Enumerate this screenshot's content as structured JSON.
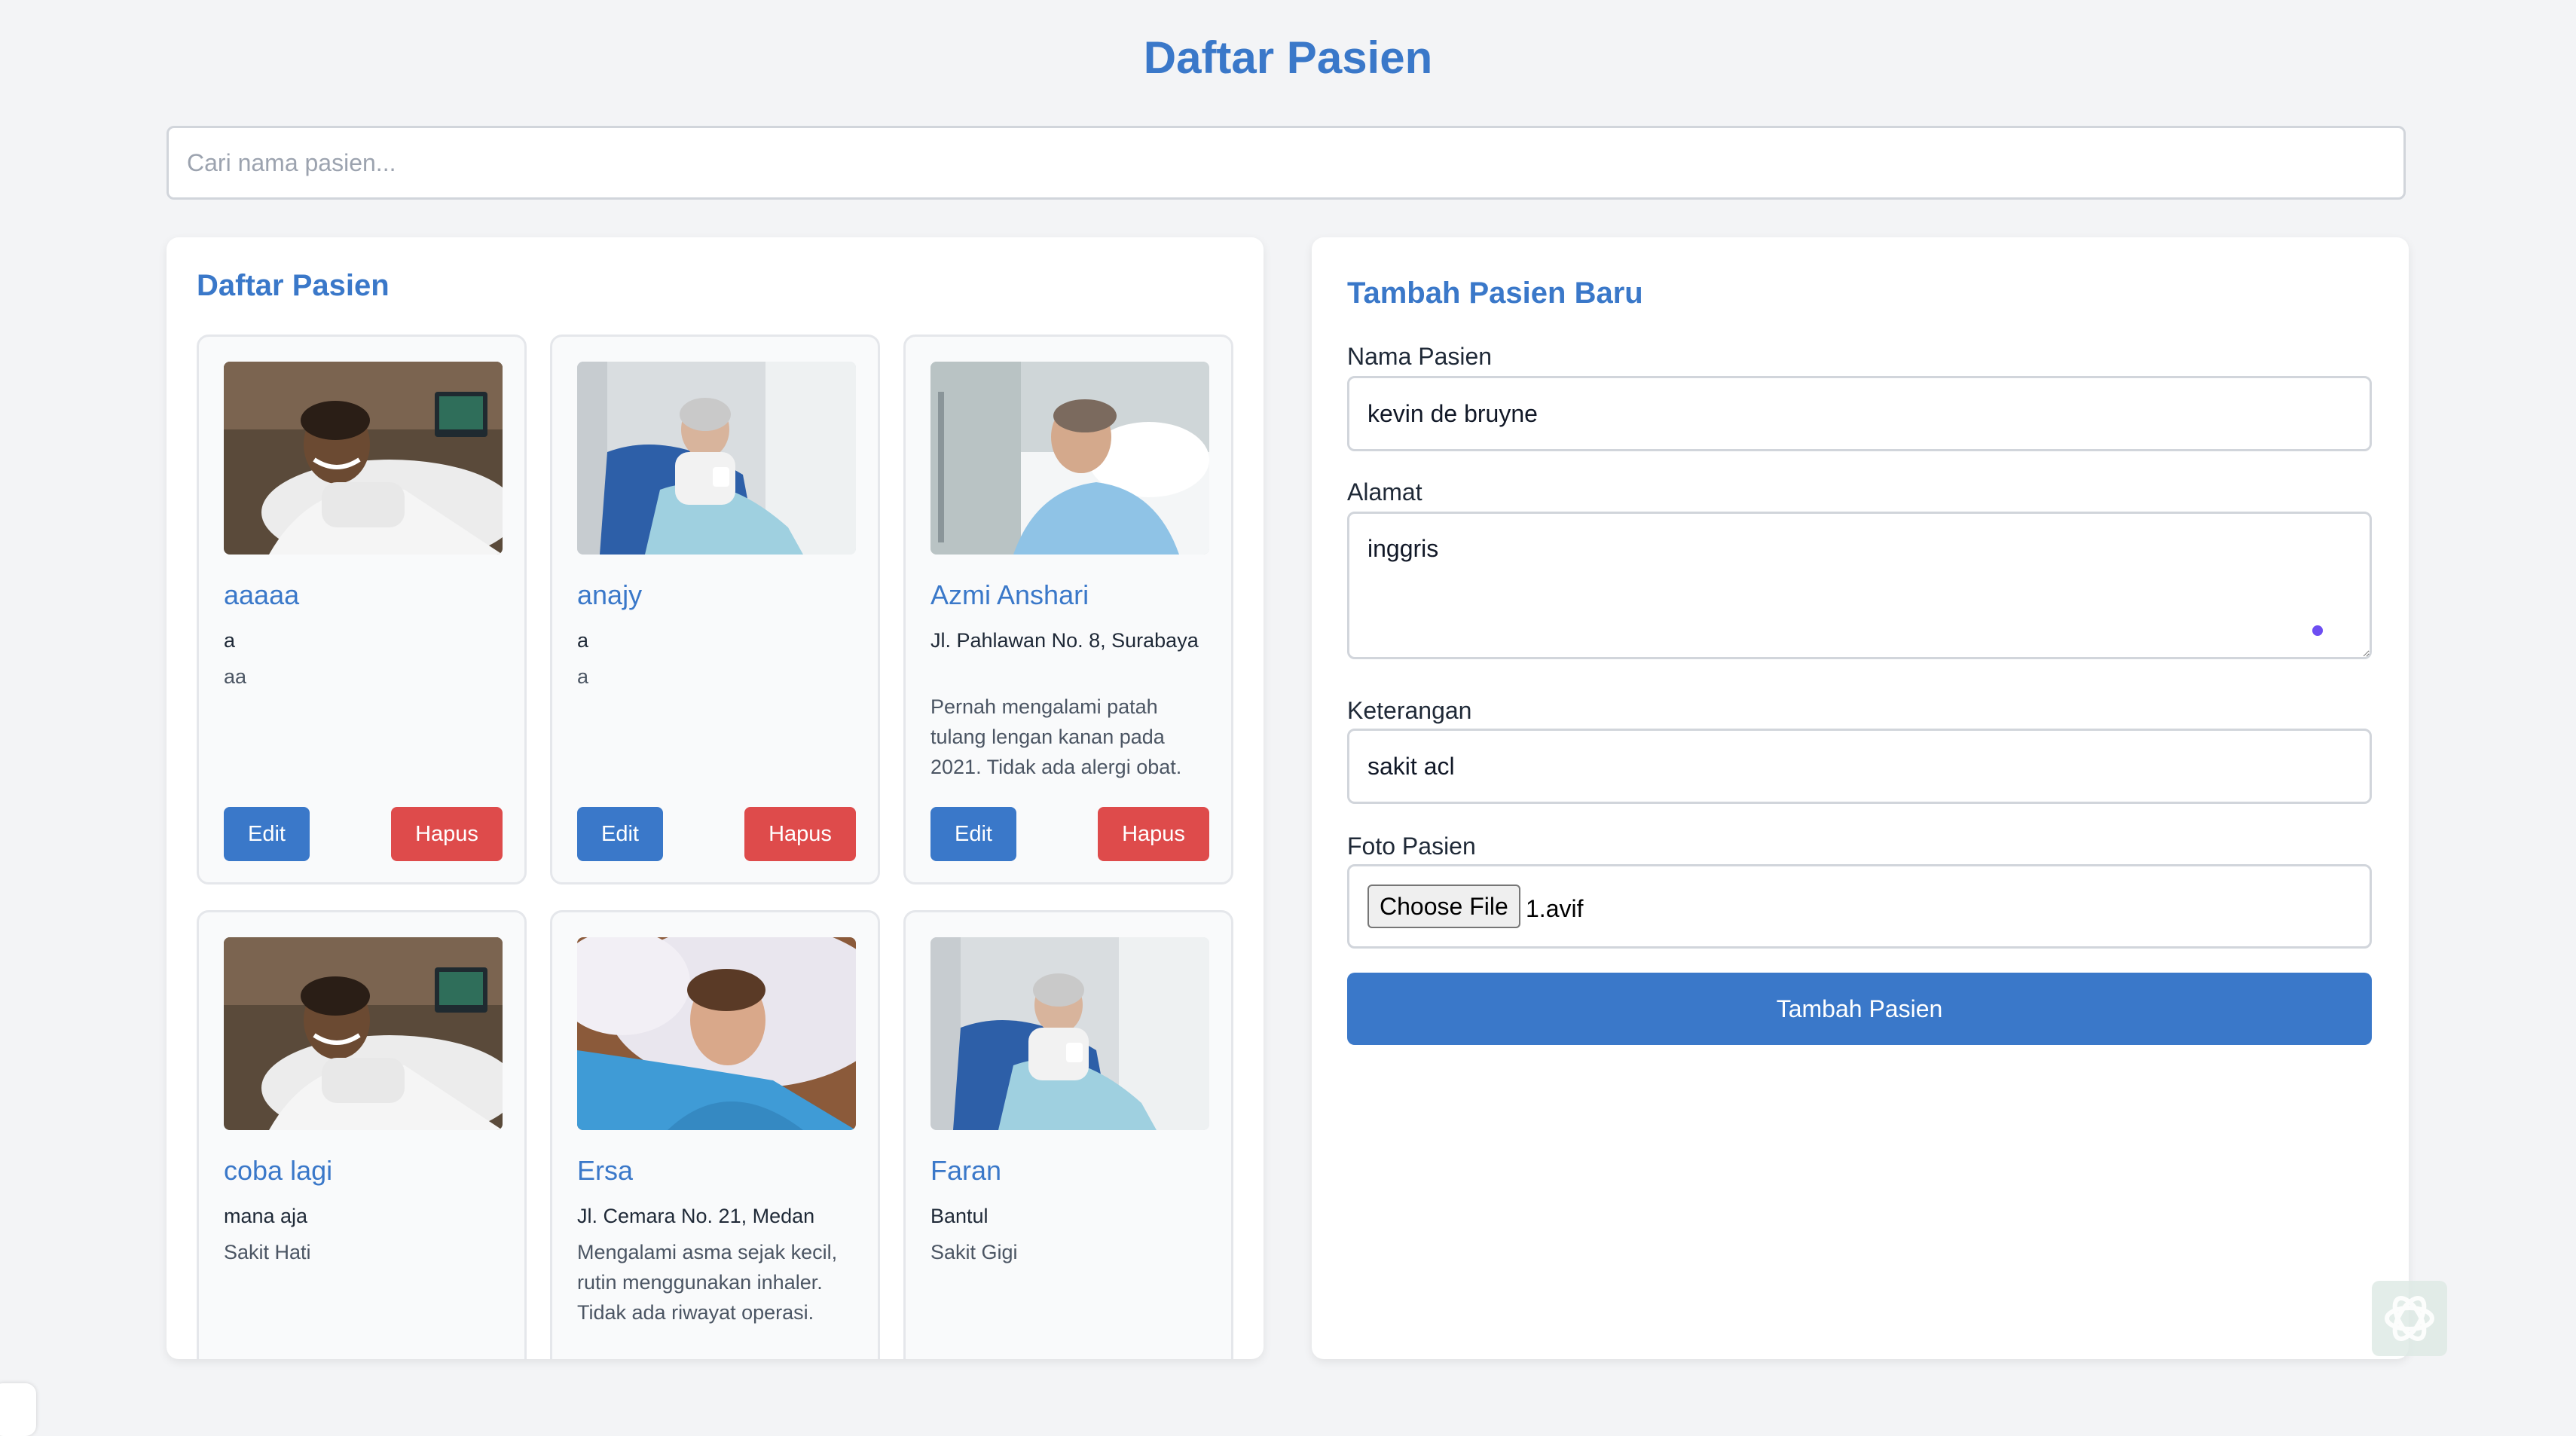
{
  "page": {
    "title": "Daftar Pasien"
  },
  "search": {
    "placeholder": "Cari nama pasien...",
    "icon": "search-icon"
  },
  "list_panel": {
    "title": "Daftar Pasien",
    "edit_label": "Edit",
    "delete_label": "Hapus",
    "patients": [
      {
        "name": "aaaaa",
        "address": "a",
        "notes": "aa",
        "photo": "patient-smiling-in-bed-photo"
      },
      {
        "name": "anajy",
        "address": "a",
        "notes": "a",
        "photo": "elderly-patient-in-chair-photo"
      },
      {
        "name": "Azmi Anshari",
        "address": "Jl. Pahlawan No. 8, Surabaya",
        "notes": "Pernah mengalami patah tulang lengan kanan pada 2021. Tidak ada alergi obat.",
        "photo": "patient-looking-up-photo"
      },
      {
        "name": "coba lagi",
        "address": "mana aja",
        "notes": "Sakit Hati",
        "photo": "patient-smiling-in-bed-photo"
      },
      {
        "name": "Ersa",
        "address": "Jl. Cemara No. 21, Medan",
        "notes": "Mengalami asma sejak kecil, rutin menggunakan inhaler. Tidak ada riwayat operasi.",
        "photo": "patient-lying-on-pillow-photo"
      },
      {
        "name": "Faran",
        "address": "Bantul",
        "notes": "Sakit Gigi",
        "photo": "elderly-patient-in-chair-photo"
      }
    ]
  },
  "form": {
    "title": "Tambah Pasien Baru",
    "name_label": "Nama Pasien",
    "name_value": "kevin de bruyne",
    "address_label": "Alamat",
    "address_value": "inggris",
    "notes_label": "Keterangan",
    "notes_value": "sakit acl",
    "photo_label": "Foto Pasien",
    "file_button_label": "Choose File",
    "file_name": "1.avif",
    "submit_label": "Tambah Pasien"
  },
  "colors": {
    "accent": "#3a78c9",
    "danger": "#de4b4b",
    "background": "#f3f4f6"
  }
}
